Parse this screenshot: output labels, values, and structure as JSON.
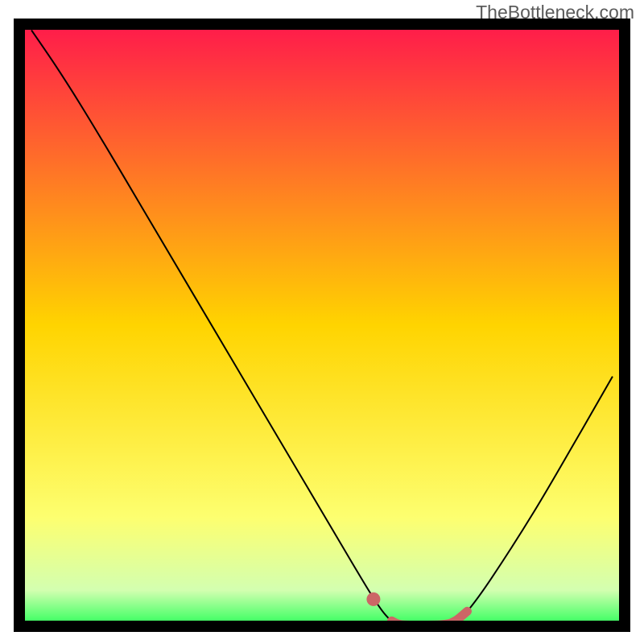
{
  "watermark": "TheBottleneck.com",
  "chart_data": {
    "type": "line",
    "title": "",
    "xlabel": "",
    "ylabel": "",
    "xlim": [
      0,
      100
    ],
    "ylim": [
      0,
      100
    ],
    "gradient_stops": [
      {
        "offset": 0,
        "color": "#ff1a4b"
      },
      {
        "offset": 50,
        "color": "#ffd400"
      },
      {
        "offset": 82,
        "color": "#fdff70"
      },
      {
        "offset": 94,
        "color": "#d3ffb0"
      },
      {
        "offset": 100,
        "color": "#2bff5a"
      }
    ],
    "series": [
      {
        "name": "bottleneck-curve",
        "color": "#000000",
        "width": 2,
        "points": [
          {
            "x": 2.0,
            "y": 99.0
          },
          {
            "x": 6.0,
            "y": 93.1
          },
          {
            "x": 10.0,
            "y": 86.8
          },
          {
            "x": 15.0,
            "y": 78.5
          },
          {
            "x": 20.0,
            "y": 70.0
          },
          {
            "x": 30.0,
            "y": 53.0
          },
          {
            "x": 40.0,
            "y": 36.0
          },
          {
            "x": 50.0,
            "y": 19.0
          },
          {
            "x": 55.0,
            "y": 10.5
          },
          {
            "x": 58.0,
            "y": 5.5
          },
          {
            "x": 60.0,
            "y": 2.5
          },
          {
            "x": 61.5,
            "y": 0.9
          },
          {
            "x": 63.0,
            "y": 0.3
          },
          {
            "x": 66.0,
            "y": 0.2
          },
          {
            "x": 70.0,
            "y": 0.3
          },
          {
            "x": 72.0,
            "y": 0.9
          },
          {
            "x": 74.0,
            "y": 2.5
          },
          {
            "x": 78.0,
            "y": 8.0
          },
          {
            "x": 85.0,
            "y": 19.0
          },
          {
            "x": 92.0,
            "y": 31.0
          },
          {
            "x": 98.0,
            "y": 41.5
          }
        ]
      },
      {
        "name": "highlight-segment",
        "color": "#cc6666",
        "width": 11,
        "cap": "round",
        "points": [
          {
            "x": 61.5,
            "y": 0.9
          },
          {
            "x": 63.0,
            "y": 0.3
          },
          {
            "x": 66.0,
            "y": 0.2
          },
          {
            "x": 70.0,
            "y": 0.3
          },
          {
            "x": 72.0,
            "y": 0.9
          },
          {
            "x": 74.0,
            "y": 2.5
          }
        ]
      }
    ],
    "marker": {
      "name": "highlight-detached-dot",
      "color": "#cc6666",
      "x": 58.5,
      "y": 4.5,
      "r": 1.2
    }
  }
}
